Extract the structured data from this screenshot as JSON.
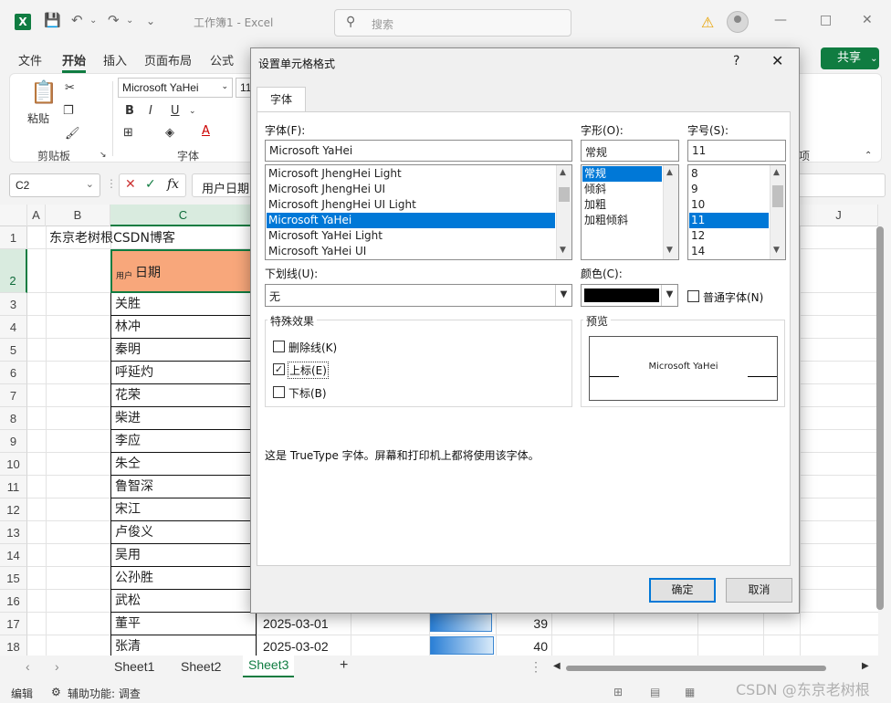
{
  "window": {
    "app_letter": "X",
    "title": "工作簿1  -  Excel",
    "search_placeholder": "搜索",
    "icons": [
      "save-icon",
      "undo-icon",
      "redo-icon",
      "warning-icon",
      "avatar",
      "minimize-icon",
      "maximize-icon",
      "close-icon"
    ]
  },
  "ribbon": {
    "tabs": [
      "文件",
      "开始",
      "插入",
      "页面布局",
      "公式"
    ],
    "active_tab": "开始",
    "share_label": "共享",
    "clipboard_label": "剪贴板",
    "paste_label": "粘贴",
    "font_group_label": "字体",
    "font_name": "Microsoft YaHei",
    "font_size": "11",
    "right_group_label": "项",
    "bold": "B",
    "italic": "I",
    "underline": "U"
  },
  "formula_bar": {
    "name_box": "C2",
    "fx": "fx",
    "content": "用户日期"
  },
  "sheet": {
    "columns": [
      "A",
      "B",
      "C",
      "J"
    ],
    "selected_column": "C",
    "rows": [
      "1",
      "2",
      "3",
      "4",
      "5",
      "6",
      "7",
      "8",
      "9",
      "10",
      "11",
      "12",
      "13",
      "14",
      "15",
      "16",
      "17",
      "18"
    ],
    "selected_row": "2",
    "b1": "东京老树根CSDN博客",
    "c2_superscript": "用户",
    "c2_main": "日期",
    "names": [
      "关胜",
      "林冲",
      "秦明",
      "呼延灼",
      "花荣",
      "柴进",
      "李应",
      "朱仝",
      "鲁智深",
      "宋江",
      "卢俊义",
      "吴用",
      "公孙胜",
      "武松",
      "董平",
      "张清"
    ],
    "dates": [
      "2025-03-01",
      "2025-03-02"
    ],
    "values": [
      "39",
      "40"
    ],
    "colors": {
      "header_fill": "#f8a77b",
      "accent": "#107c41",
      "databar": "#2a7fd6"
    }
  },
  "sheet_tabs": [
    "Sheet1",
    "Sheet2",
    "Sheet3"
  ],
  "active_sheet": "Sheet3",
  "status": {
    "mode": "编辑",
    "accessibility": "辅助功能: 调查"
  },
  "watermark": "CSDN @东京老树根",
  "dialog": {
    "title": "设置单元格格式",
    "help": "?",
    "tab": "字体",
    "font_label": "字体(F):",
    "font_value": "Microsoft YaHei",
    "font_list": [
      "Microsoft JhengHei Light",
      "Microsoft JhengHei UI",
      "Microsoft JhengHei UI Light",
      "Microsoft YaHei",
      "Microsoft YaHei Light",
      "Microsoft YaHei UI"
    ],
    "font_selected": "Microsoft YaHei",
    "style_label": "字形(O):",
    "style_value": "常规",
    "style_list": [
      "常规",
      "倾斜",
      "加粗",
      "加粗倾斜"
    ],
    "style_selected": "常规",
    "size_label": "字号(S):",
    "size_value": "11",
    "size_list": [
      "8",
      "9",
      "10",
      "11",
      "12",
      "14"
    ],
    "size_selected": "11",
    "underline_label": "下划线(U):",
    "underline_value": "无",
    "color_label": "颜色(C):",
    "color_value": "#000000",
    "normal_font_label": "普通字体(N)",
    "effects_legend": "特殊效果",
    "strikethrough_label": "删除线(K)",
    "superscript_label": "上标(E)",
    "subscript_label": "下标(B)",
    "strikethrough_checked": false,
    "superscript_checked": true,
    "subscript_checked": false,
    "preview_legend": "预览",
    "preview_text": "Microsoft YaHei",
    "info_text": "这是 TrueType 字体。屏幕和打印机上都将使用该字体。",
    "ok_label": "确定",
    "cancel_label": "取消"
  }
}
